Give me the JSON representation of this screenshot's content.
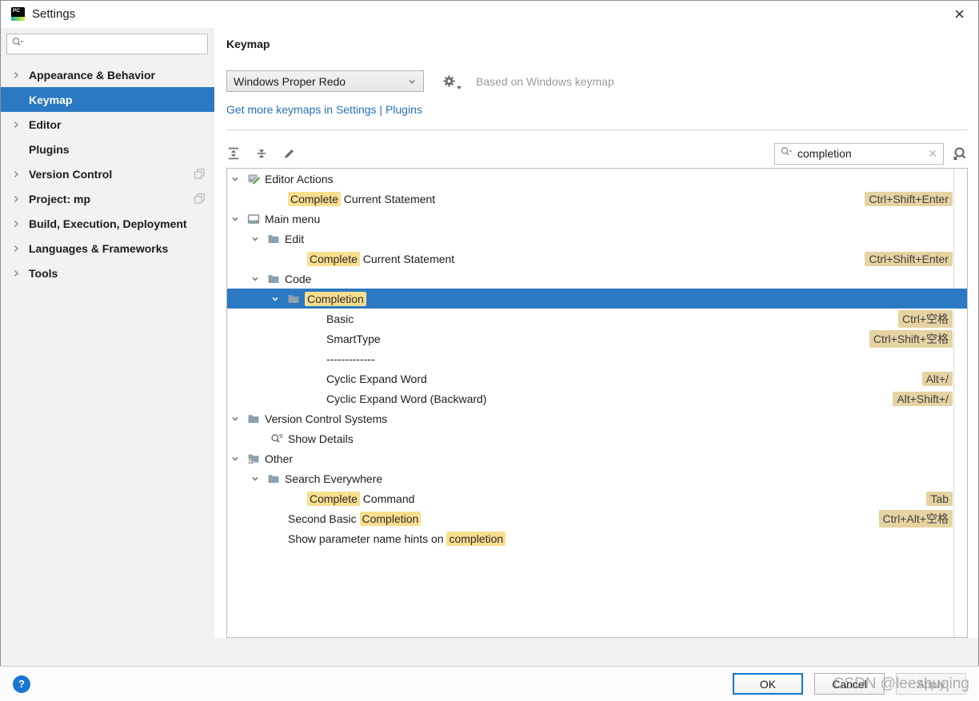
{
  "window": {
    "title": "Settings",
    "close": "×"
  },
  "sidebar": {
    "items": [
      {
        "label": "Appearance & Behavior",
        "chevron": true,
        "selected": false,
        "shared": false
      },
      {
        "label": "Keymap",
        "chevron": false,
        "selected": true,
        "shared": false
      },
      {
        "label": "Editor",
        "chevron": true,
        "selected": false,
        "shared": false
      },
      {
        "label": "Plugins",
        "chevron": false,
        "selected": false,
        "shared": false
      },
      {
        "label": "Version Control",
        "chevron": true,
        "selected": false,
        "shared": true
      },
      {
        "label": "Project: mp",
        "chevron": true,
        "selected": false,
        "shared": true
      },
      {
        "label": "Build, Execution, Deployment",
        "chevron": true,
        "selected": false,
        "shared": false
      },
      {
        "label": "Languages & Frameworks",
        "chevron": true,
        "selected": false,
        "shared": false
      },
      {
        "label": "Tools",
        "chevron": true,
        "selected": false,
        "shared": false
      }
    ]
  },
  "header": {
    "title": "Keymap",
    "keymap": "Windows Proper Redo",
    "based_on": "Based on Windows keymap",
    "more_link": "Get more keymaps in Settings | Plugins"
  },
  "filter": {
    "value": "completion"
  },
  "tree": [
    {
      "pad": 4,
      "chevron": true,
      "icon": "editor-actions",
      "segs": [
        [
          "Editor Actions",
          false
        ]
      ]
    },
    {
      "pad": 76,
      "segs": [
        [
          "Complete",
          true
        ],
        [
          " Current Statement",
          false
        ]
      ],
      "shortcut": "Ctrl+Shift+Enter"
    },
    {
      "pad": 4,
      "chevron": true,
      "icon": "main-menu",
      "segs": [
        [
          "Main menu",
          false
        ]
      ]
    },
    {
      "pad": 29,
      "chevron": true,
      "icon": "folder",
      "segs": [
        [
          "Edit",
          false
        ]
      ]
    },
    {
      "pad": 100,
      "segs": [
        [
          "Complete",
          true
        ],
        [
          " Current Statement",
          false
        ]
      ],
      "shortcut": "Ctrl+Shift+Enter"
    },
    {
      "pad": 29,
      "chevron": true,
      "icon": "folder",
      "segs": [
        [
          "Code",
          false
        ]
      ]
    },
    {
      "pad": 54,
      "chevron": true,
      "icon": "folder",
      "segs": [
        [
          "Completion",
          true
        ]
      ],
      "selected": true
    },
    {
      "pad": 124,
      "segs": [
        [
          "Basic",
          false
        ]
      ],
      "shortcut": "Ctrl+空格"
    },
    {
      "pad": 124,
      "segs": [
        [
          "SmartType",
          false
        ]
      ],
      "shortcut": "Ctrl+Shift+空格"
    },
    {
      "pad": 124,
      "segs": [
        [
          "-------------",
          false
        ]
      ]
    },
    {
      "pad": 124,
      "segs": [
        [
          "Cyclic Expand Word",
          false
        ]
      ],
      "shortcut": "Alt+/"
    },
    {
      "pad": 124,
      "segs": [
        [
          "Cyclic Expand Word (Backward)",
          false
        ]
      ],
      "shortcut": "Alt+Shift+/"
    },
    {
      "pad": 4,
      "chevron": true,
      "icon": "folder",
      "segs": [
        [
          "Version Control Systems",
          false
        ]
      ]
    },
    {
      "pad": 54,
      "icon": "show-details",
      "segs": [
        [
          "Show Details",
          false
        ]
      ]
    },
    {
      "pad": 4,
      "chevron": true,
      "icon": "folder-dots",
      "segs": [
        [
          "Other",
          false
        ]
      ]
    },
    {
      "pad": 29,
      "chevron": true,
      "icon": "folder",
      "segs": [
        [
          "Search Everywhere",
          false
        ]
      ]
    },
    {
      "pad": 100,
      "segs": [
        [
          "Complete",
          true
        ],
        [
          " Command",
          false
        ]
      ],
      "shortcut": "Tab"
    },
    {
      "pad": 76,
      "segs": [
        [
          "Second Basic ",
          false
        ],
        [
          "Completion",
          true
        ]
      ],
      "shortcut": "Ctrl+Alt+空格"
    },
    {
      "pad": 76,
      "segs": [
        [
          "Show parameter name hints on ",
          false
        ],
        [
          "completion",
          true
        ]
      ]
    }
  ],
  "footer": {
    "help": "?",
    "ok": "OK",
    "cancel": "Cancel",
    "apply": "Apply"
  },
  "watermark": "CSDN @leeshuqing",
  "colors": {
    "accent": "#2B79C2",
    "match_highlight": "#F9DE8E",
    "shortcut_chip": "#E5D3A1",
    "link": "#2572B9",
    "help_button": "#1976D2"
  }
}
